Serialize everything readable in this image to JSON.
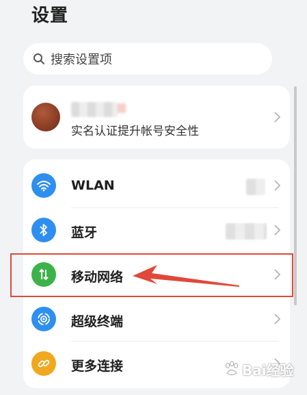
{
  "header": {
    "title": "设置"
  },
  "search": {
    "placeholder": "搜索设置项",
    "icon": "search-icon"
  },
  "account": {
    "subtitle": "实名认证提升帐号安全性"
  },
  "settings": {
    "items": [
      {
        "label": "WLAN",
        "icon": "wifi-icon",
        "color": "#2f8ff0"
      },
      {
        "label": "蓝牙",
        "icon": "bluetooth-icon",
        "color": "#2f8ff0"
      },
      {
        "label": "移动网络",
        "icon": "mobile-data-icon",
        "color": "#3cb34a"
      },
      {
        "label": "超级终端",
        "icon": "super-device-icon",
        "color": "#2f8ff0"
      },
      {
        "label": "更多连接",
        "icon": "link-icon",
        "color": "#f0a81e"
      }
    ]
  },
  "annotation": {
    "highlight_color": "#e0483a"
  },
  "watermark": {
    "text": "Bai经验"
  }
}
